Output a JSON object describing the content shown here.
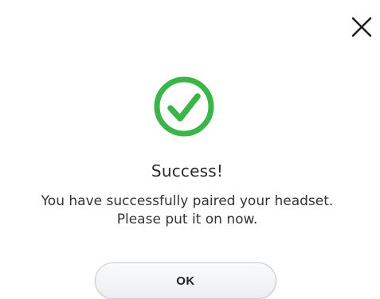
{
  "dialog": {
    "close_icon": "close-icon",
    "status_icon": "check-circle-icon",
    "accent_color": "#3bb54a",
    "title": "Success!",
    "message_line1": "You have successfully paired your headset.",
    "message_line2": "Please put it on now.",
    "ok_label": "OK"
  }
}
